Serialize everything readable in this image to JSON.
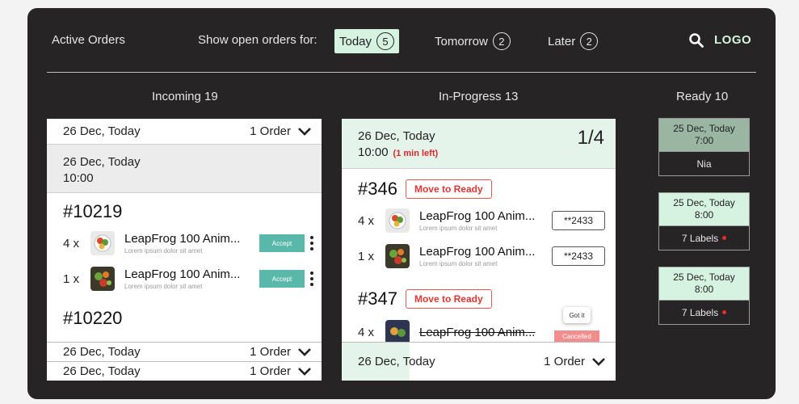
{
  "header": {
    "title": "Active Orders",
    "filter_label": "Show open orders for:",
    "filters": [
      {
        "label": "Today",
        "count": "5"
      },
      {
        "label": "Tomorrow",
        "count": "2"
      },
      {
        "label": "Later",
        "count": "2"
      }
    ],
    "logo": "LOGO"
  },
  "columns": {
    "incoming": "Incoming 19",
    "in_progress": "In-Progress 13",
    "ready": "Ready 10"
  },
  "incoming": {
    "top_row": {
      "date": "26 Dec, Today",
      "orders": "1 Order"
    },
    "slot": {
      "date": "26 Dec, Today",
      "time": "10:00"
    },
    "order1": {
      "number": "#10219",
      "items": [
        {
          "qty": "4 x",
          "name": "LeapFrog 100 Anim...",
          "desc": "Lorem ipsum dolor sit amet",
          "action": "Accept"
        },
        {
          "qty": "1 x",
          "name": "LeapFrog 100 Anim...",
          "desc": "Lorem ipsum dolor sit amet",
          "action": "Accept"
        }
      ]
    },
    "order2": {
      "number": "#10220"
    },
    "bottom_rows": [
      {
        "date": "26 Dec, Today",
        "orders": "1 Order"
      },
      {
        "date": "26 Dec, Today",
        "orders": "1 Order"
      }
    ]
  },
  "in_progress": {
    "slot": {
      "date": "26 Dec, Today",
      "time": "10:00",
      "time_left": "(1 min left)",
      "fraction": "1/4"
    },
    "order1": {
      "number": "#346",
      "action": "Move to Ready",
      "items": [
        {
          "qty": "4 x",
          "name": "LeapFrog 100 Anim...",
          "desc": "Lorem ipsum dolor sit amet",
          "code": "**2433"
        },
        {
          "qty": "1 x",
          "name": "LeapFrog 100 Anim...",
          "desc": "Lorem ipsum dolor sit amet",
          "code": "**2433"
        }
      ]
    },
    "order2": {
      "number": "#347",
      "action": "Move to Ready",
      "item": {
        "qty": "4 x",
        "name": "LeapFrog 100 Anim..."
      },
      "tooltip": "Got it",
      "status": "Cancelled"
    },
    "bottom_row": {
      "date": "26 Dec, Today",
      "orders": "1 Order"
    }
  },
  "ready": [
    {
      "date": "25 Dec, Today",
      "time": "7:00",
      "footer": "Nia",
      "color": "#9bb5a3"
    },
    {
      "date": "25 Dec, Today",
      "time": "8:00",
      "footer": "7 Labels",
      "color": "#d6f2e1"
    },
    {
      "date": "25 Dec, Today",
      "time": "8:00",
      "footer": "7 Labels",
      "color": "#d6f2e1"
    }
  ],
  "colors": {
    "accent_green": "#5ab8ab",
    "highlight_mint": "#d6f2e1",
    "alert_red": "#e03535",
    "panel_dark": "#262424"
  }
}
